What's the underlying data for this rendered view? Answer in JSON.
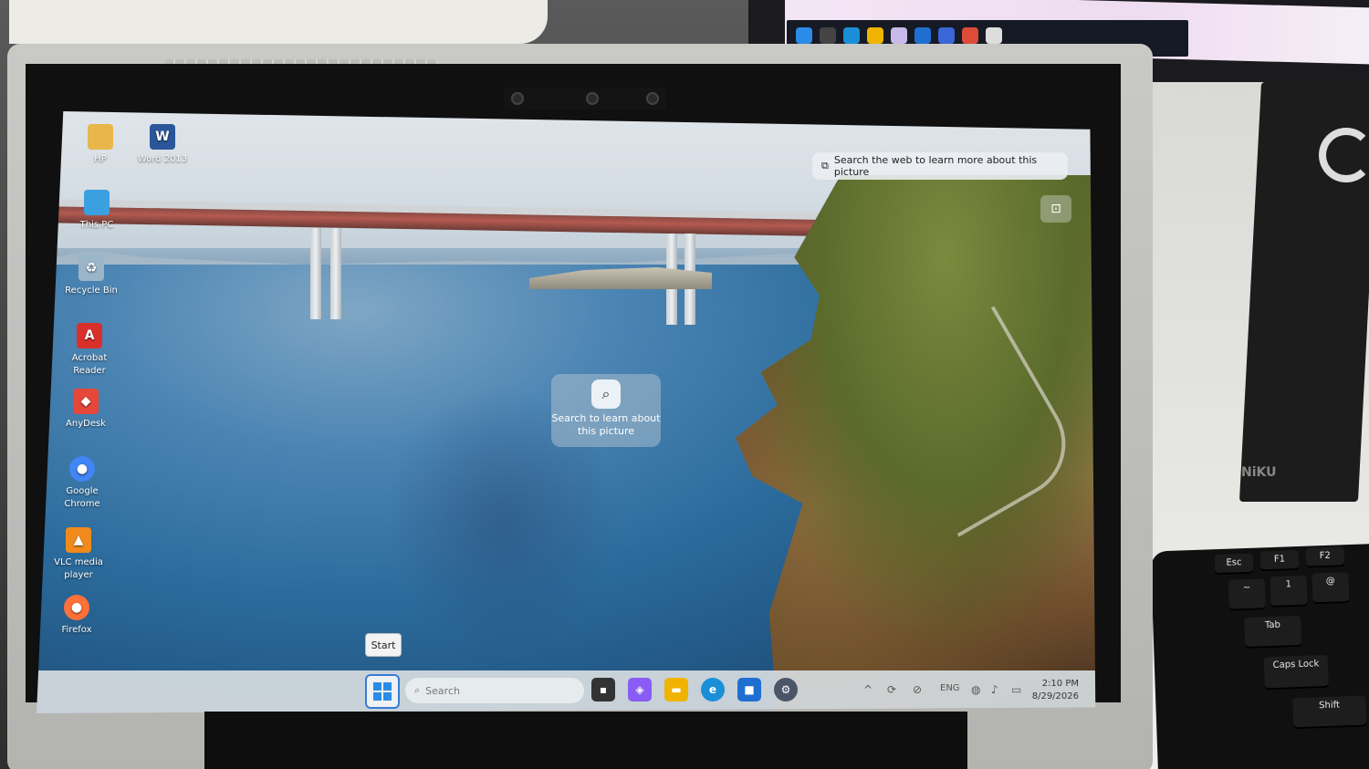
{
  "desktop": {
    "icons": [
      {
        "label": "HP",
        "icon": "folder-icon",
        "color": "#e8b64a"
      },
      {
        "label": "Word 2013",
        "icon": "word-icon",
        "color": "#2b579a"
      },
      {
        "label": "This PC",
        "icon": "monitor-icon",
        "color": "#3aa0e0"
      },
      {
        "label": "Recycle Bin",
        "icon": "recycle-bin-icon",
        "color": "#9bb5c9"
      },
      {
        "label": "Acrobat Reader",
        "icon": "acrobat-icon",
        "color": "#d9302c"
      },
      {
        "label": "AnyDesk",
        "icon": "anydesk-icon",
        "color": "#e5473b"
      },
      {
        "label": "Google Chrome",
        "icon": "chrome-icon",
        "color": "#4285f4"
      },
      {
        "label": "VLC media player",
        "icon": "vlc-icon",
        "color": "#f08a1c"
      },
      {
        "label": "Firefox",
        "icon": "firefox-icon",
        "color": "#ff7139"
      }
    ]
  },
  "spotlight": {
    "web_search_label": "Search the web to learn more about this picture",
    "card_label": "Search to learn about this picture"
  },
  "tooltip": {
    "start": "Start"
  },
  "taskbar": {
    "search_placeholder": "Search",
    "apps": [
      {
        "name": "task-view",
        "color": "#333333"
      },
      {
        "name": "copilot",
        "color": "#8a5cf6"
      },
      {
        "name": "file-explorer",
        "color": "#f0b400"
      },
      {
        "name": "edge",
        "color": "#1a8fd8"
      },
      {
        "name": "microsoft-store",
        "color": "#1f6fd1"
      },
      {
        "name": "settings",
        "color": "#4a5568"
      }
    ],
    "tray": {
      "language": "ENG",
      "time": "2:10 PM",
      "date": "8/29/2026"
    }
  },
  "keyboard": {
    "keys": [
      "Esc",
      "F1",
      "F2",
      "~",
      "!",
      "1",
      "@",
      "Tab",
      "Caps Lock",
      "Shift"
    ]
  },
  "background": {
    "brand": "NiKU"
  }
}
